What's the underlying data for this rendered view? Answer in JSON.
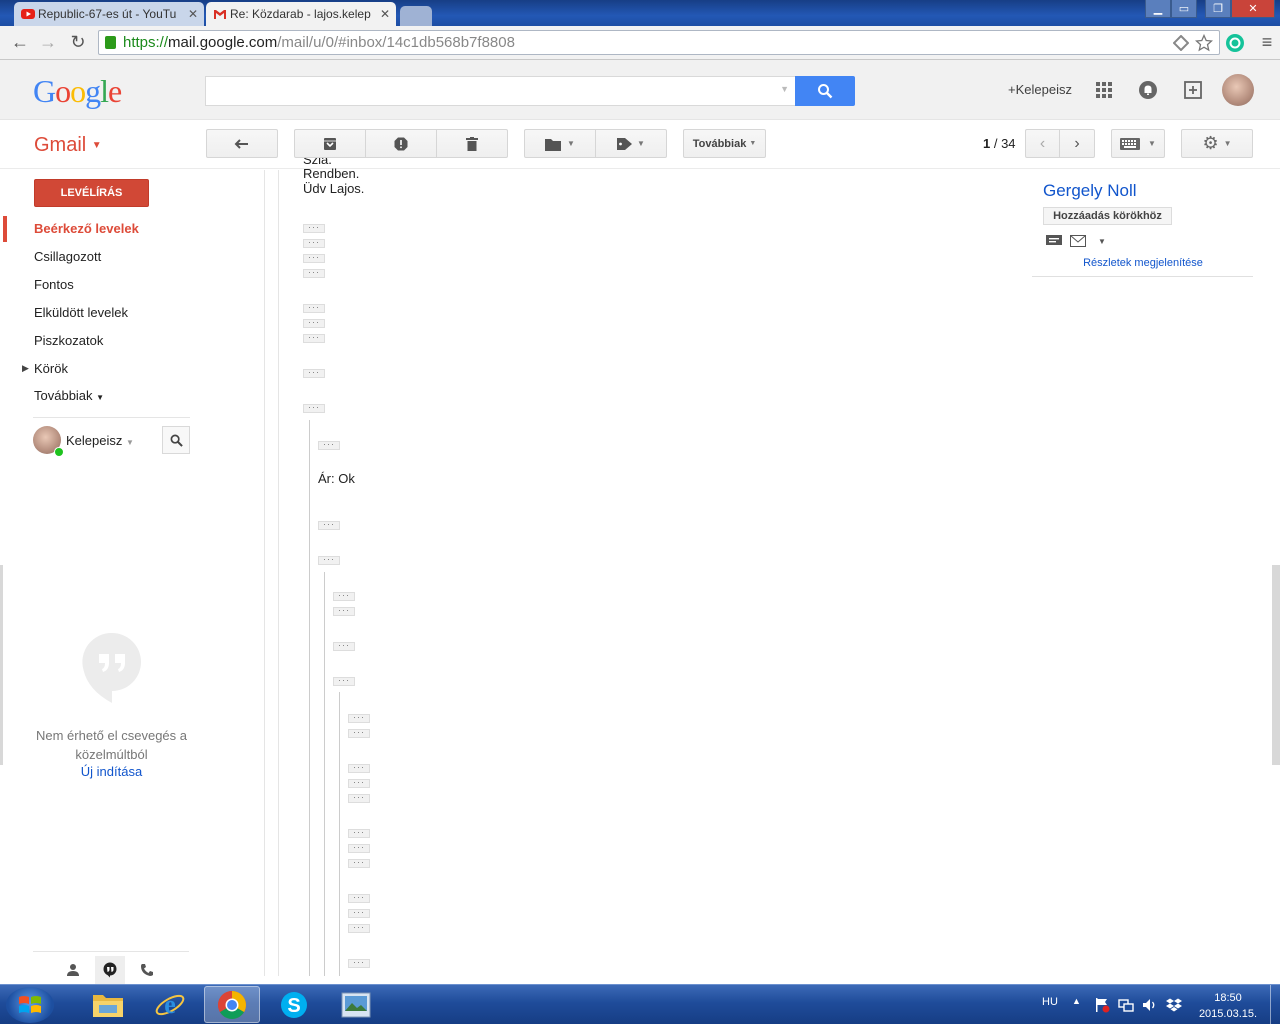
{
  "browser": {
    "tabs": [
      {
        "title": "Republic-67-es út - YouTu",
        "close": "✕"
      },
      {
        "title": "Re: Közdarab - lajos.kelep",
        "close": "✕"
      }
    ],
    "url": {
      "scheme": "https://",
      "host": "mail.google.com",
      "path": "/mail/u/0/#inbox/14c1db568b7f8808"
    }
  },
  "header": {
    "logo": "Google",
    "user_link": "+Kelepeisz",
    "icons": [
      "apps-icon",
      "notifications-icon",
      "share-icon",
      "avatar"
    ]
  },
  "toolbar": {
    "app_label": "Gmail",
    "more_label": "Továbbiak",
    "pager": {
      "current": "1",
      "separator": " / ",
      "total": "34"
    },
    "buttons": [
      "reply-icon",
      "archive-icon",
      "report-spam-icon",
      "delete-icon",
      "move-to-icon",
      "labels-icon",
      "keyboard-icon",
      "settings-icon"
    ]
  },
  "sidebar": {
    "compose": "LEVÉLÍRÁS",
    "items": [
      {
        "label": "Beérkező levelek",
        "active": true
      },
      {
        "label": "Csillagozott"
      },
      {
        "label": "Fontos"
      },
      {
        "label": "Elküldött levelek"
      },
      {
        "label": "Piszkozatok"
      },
      {
        "label": "Körök"
      },
      {
        "label": "Továbbiak"
      }
    ],
    "chat_user": "Kelepeisz",
    "no_chat": "Nem érhető el csevegés a közelmúltból",
    "new_chat": "Új indítása"
  },
  "message": {
    "partial_line": "Szia.",
    "line1": "Rendben.",
    "line2": "Üdv Lajos.",
    "price": "Ár: Ok",
    "ellipsis": "···"
  },
  "contact": {
    "name": "Gergely Noll",
    "add_button": "Hozzáadás körökhöz",
    "details_link": "Részletek megjelenítése"
  },
  "taskbar": {
    "apps": [
      "explorer-icon",
      "internet-explorer-icon",
      "chrome-icon",
      "skype-icon",
      "image-viewer-icon"
    ],
    "language": "HU",
    "time": "18:50",
    "date": "2015.03.15."
  },
  "colors": {
    "gmail_red": "#dd4b39",
    "compose_red": "#d14836",
    "search_blue": "#4285f4",
    "link_blue": "#1155cc"
  }
}
